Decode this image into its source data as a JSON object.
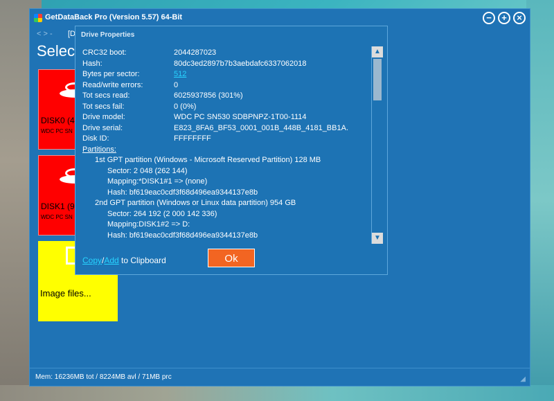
{
  "window": {
    "title": "GetDataBack Pro (Version 5.57) 64-Bit",
    "nav_arrows": "< >  -",
    "breadcrumb": "[D",
    "page_title": "Select",
    "controls": {
      "minimize": "−",
      "maximize": "+",
      "close": "×"
    }
  },
  "tiles": [
    {
      "name": "DISK0 (4",
      "sub": "WDC PC SN"
    },
    {
      "name": "DISK1 (9",
      "sub": "WDC PC SN"
    },
    {
      "name": "Image files..."
    }
  ],
  "status": {
    "text": "Mem: 16236MB tot / 8224MB avl / 71MB prc"
  },
  "dialog": {
    "title": "Drive Properties",
    "properties": [
      {
        "key": "CRC32 boot:",
        "value": "2044287023"
      },
      {
        "key": "Hash:",
        "value": "80dc3ed2897b7b3aebdafc6337062018"
      },
      {
        "key": "Bytes per sector:",
        "value": "512"
      },
      {
        "key": "Read/write errors:",
        "value": "0"
      },
      {
        "key": "Tot secs read:",
        "value": "6025937856 (301%)"
      },
      {
        "key": "Tot secs fail:",
        "value": "0 (0%)"
      },
      {
        "key": "Drive model:",
        "value": "WDC PC SN530 SDBPNPZ-1T00-1114"
      },
      {
        "key": "Drive serial:",
        "value": "E823_8FA6_BF53_0001_001B_448B_4181_BB1A."
      },
      {
        "key": "Disk ID:",
        "value": "FFFFFFFF"
      }
    ],
    "partitions_label": "Partitions:",
    "partitions": [
      {
        "title": "1st GPT partition (Windows - Microsoft Reserved Partition) 128 MB",
        "sector": "Sector:   2 048 (262 144)",
        "mapping": "Mapping:*DISK1#1 => (none)",
        "hash": "Hash:     bf619eac0cdf3f68d496ea9344137e8b"
      },
      {
        "title": "2nd GPT partition (Windows or Linux data partition) 954 GB",
        "sector": "Sector:   264 192 (2 000 142 336)",
        "mapping": "Mapping:DISK1#2 => D:",
        "hash": "Hash:     bf619eac0cdf3f68d496ea9344137e8b"
      }
    ],
    "copy_link": "Copy",
    "slash": "/",
    "add_link": "Add",
    "clipboard_text": " to Clipboard",
    "ok_label": "Ok",
    "scroll_up": "▲",
    "scroll_down": "▼"
  }
}
